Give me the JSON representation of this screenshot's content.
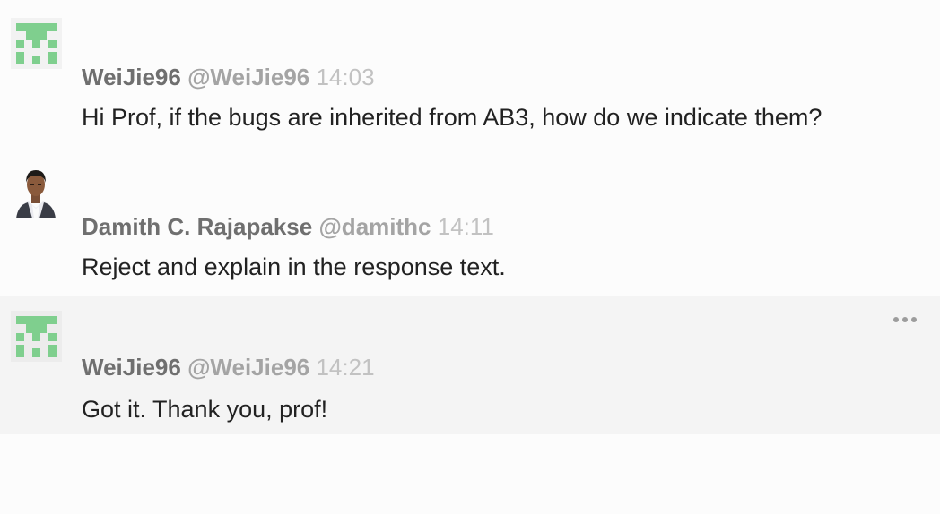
{
  "messages": [
    {
      "name": "WeiJie96",
      "handle": "@WeiJie96",
      "time": "14:03",
      "text": "Hi Prof, if the bugs are inherited from AB3, how do we indicate them?",
      "avatar": "identicon-avatar"
    },
    {
      "name": "Damith C. Rajapakse",
      "handle": "@damithc",
      "time": "14:11",
      "text": "Reject and explain in the response text.",
      "avatar": "photo-avatar"
    },
    {
      "name": "WeiJie96",
      "handle": "@WeiJie96",
      "time": "14:21",
      "text": "Got it. Thank you, prof!",
      "avatar": "identicon-avatar"
    }
  ],
  "colors": {
    "identicon": "#7fcf8e",
    "name": "#6f6f6f",
    "handle": "#a4a4a4",
    "time": "#c2c2c2",
    "text": "#222222",
    "hover_row": "#f4f4f4"
  },
  "icons": {
    "more_actions": "more-horizontal-icon"
  }
}
